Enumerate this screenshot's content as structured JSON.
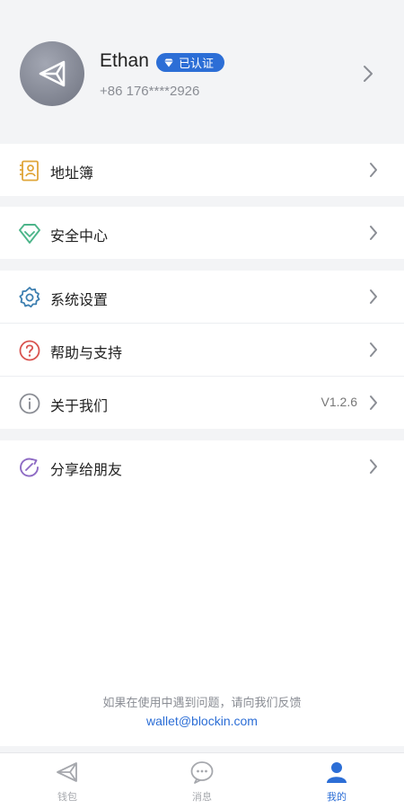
{
  "profile": {
    "name": "Ethan",
    "badge": "已认证",
    "phone": "+86 176****2926"
  },
  "menu": {
    "address_book": "地址簿",
    "security": "安全中心",
    "settings": "系统设置",
    "help": "帮助与支持",
    "about": "关于我们",
    "version": "V1.2.6",
    "share": "分享给朋友"
  },
  "footer": {
    "feedback_text": "如果在使用中遇到问题，请向我们反馈",
    "email": "wallet@blockin.com"
  },
  "tabs": [
    {
      "label": "钱包",
      "icon": "wallet-icon",
      "active": false
    },
    {
      "label": "消息",
      "icon": "message-icon",
      "active": false
    },
    {
      "label": "我的",
      "icon": "user-icon",
      "active": true
    }
  ],
  "colors": {
    "accent": "#2c6ed6",
    "address_icon": "#e0a63a",
    "security_icon": "#4db58a",
    "settings_icon": "#3d7fb0",
    "help_icon": "#d9534f",
    "about_icon": "#8a8d94",
    "share_icon": "#8e6bc4"
  }
}
